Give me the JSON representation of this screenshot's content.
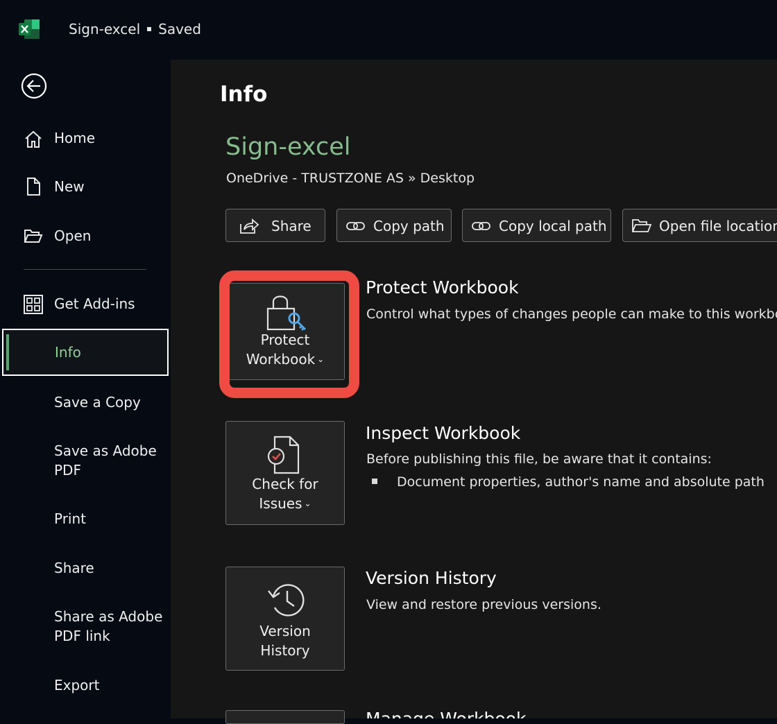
{
  "titlebar": {
    "app_icon": "excel-icon",
    "doc_name": "Sign-excel",
    "save_status": "Saved"
  },
  "sidebar": {
    "back_icon": "back-arrow-icon",
    "items": [
      {
        "label": "Home",
        "icon": "home-icon"
      },
      {
        "label": "New",
        "icon": "new-document-icon"
      },
      {
        "label": "Open",
        "icon": "open-folder-icon"
      },
      {
        "label": "Get Add-ins",
        "icon": "add-ins-grid-icon"
      },
      {
        "label": "Info",
        "selected": true
      },
      {
        "label": "Save a Copy"
      },
      {
        "label": "Save as Adobe\nPDF"
      },
      {
        "label": "Print"
      },
      {
        "label": "Share"
      },
      {
        "label": "Share as Adobe\nPDF link"
      },
      {
        "label": "Export"
      }
    ]
  },
  "main": {
    "title": "Info",
    "file_name": "Sign-excel",
    "file_path": "OneDrive - TRUSTZONE AS » Desktop",
    "actions": [
      {
        "label": "Share",
        "icon": "share-icon"
      },
      {
        "label": "Copy path",
        "icon": "link-icon"
      },
      {
        "label": "Copy local path",
        "icon": "link-icon"
      },
      {
        "label": "Open file location",
        "icon": "folder-icon"
      }
    ],
    "sections": {
      "protect": {
        "tile_line1": "Protect",
        "tile_line2": "Workbook",
        "icon": "lock-key-icon",
        "title": "Protect Workbook",
        "description": "Control what types of changes people can make to this workbook."
      },
      "inspect": {
        "tile_line1": "Check for",
        "tile_line2": "Issues",
        "icon": "inspect-document-icon",
        "title": "Inspect Workbook",
        "description": "Before publishing this file, be aware that it contains:",
        "bullets": [
          "Document properties, author's name and absolute path"
        ]
      },
      "version": {
        "tile_line1": "Version",
        "tile_line2": "History",
        "icon": "history-clock-icon",
        "title": "Version History",
        "description": "View and restore previous versions."
      },
      "manage": {
        "title": "Manage Workbook"
      }
    }
  },
  "colors": {
    "accent_green": "#86bd8e",
    "highlight_red": "#ef4b43",
    "background": "#050a13",
    "panel": "#161616"
  }
}
